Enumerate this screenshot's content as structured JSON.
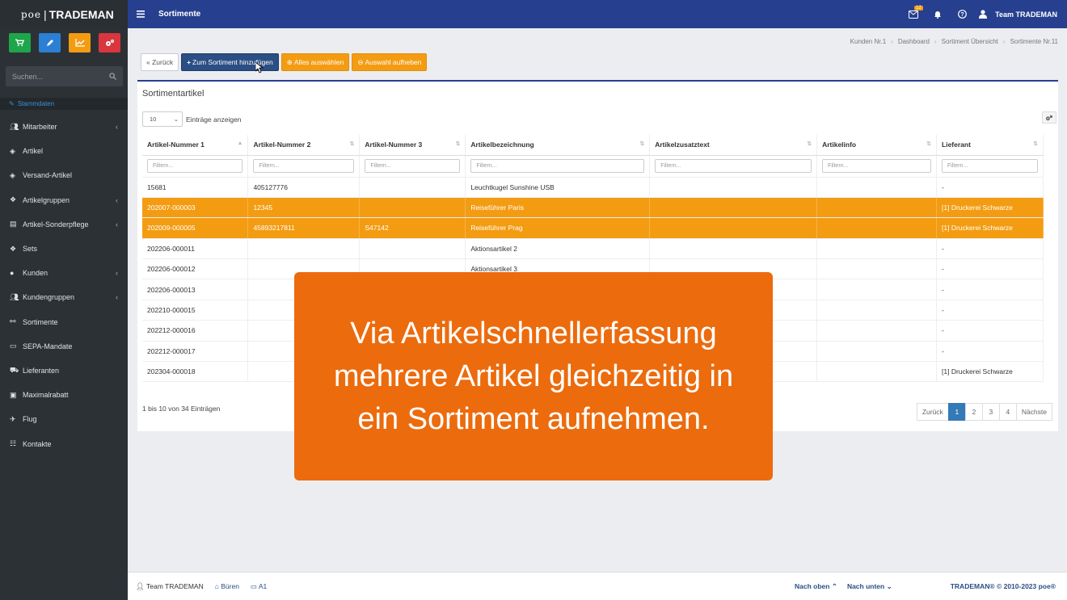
{
  "brand": {
    "poe": "poe",
    "name": "TRADEMAN"
  },
  "quick_buttons": [
    {
      "name": "cart-icon",
      "color": "#1fa54a"
    },
    {
      "name": "pencil-icon",
      "color": "#2b7fd4"
    },
    {
      "name": "chart-icon",
      "color": "#f39c12"
    },
    {
      "name": "gears-icon",
      "color": "#d9363e"
    }
  ],
  "search": {
    "placeholder": "Suchen..."
  },
  "sidebar": {
    "section": "Stammdaten",
    "items": [
      {
        "label": "Mitarbeiter",
        "icon": "users-icon",
        "has_sub": true
      },
      {
        "label": "Artikel",
        "icon": "cube-icon",
        "has_sub": false
      },
      {
        "label": "Versand-Artikel",
        "icon": "cube-icon",
        "has_sub": false
      },
      {
        "label": "Artikelgruppen",
        "icon": "cubes-icon",
        "has_sub": true
      },
      {
        "label": "Artikel-Sonderpflege",
        "icon": "table-icon",
        "has_sub": true
      },
      {
        "label": "Sets",
        "icon": "cubes-icon",
        "has_sub": false
      },
      {
        "label": "Kunden",
        "icon": "user-icon",
        "has_sub": true
      },
      {
        "label": "Kundengruppen",
        "icon": "users-icon",
        "has_sub": true
      },
      {
        "label": "Sortimente",
        "icon": "sitemap-icon",
        "has_sub": false
      },
      {
        "label": "SEPA-Mandate",
        "icon": "credit-card-icon",
        "has_sub": false
      },
      {
        "label": "Lieferanten",
        "icon": "truck-icon",
        "has_sub": false
      },
      {
        "label": "Maximalrabatt",
        "icon": "money-icon",
        "has_sub": false
      },
      {
        "label": "Flug",
        "icon": "plane-icon",
        "has_sub": false
      },
      {
        "label": "Kontakte",
        "icon": "contact-icon",
        "has_sub": false
      }
    ]
  },
  "topbar": {
    "title": "Sortimente",
    "badge": "12",
    "user": "Team TRADEMAN"
  },
  "breadcrumb": [
    "Kunden Nr.1",
    "Dashboard",
    "Sortiment Übersicht",
    "Sortimente Nr.11"
  ],
  "toolbar": {
    "back": "« Zurück",
    "add": "Zum Sortiment hinzufügen",
    "select_all": "Alles auswählen",
    "deselect": "Auswahl aufheben"
  },
  "card": {
    "title": "Sortimentartikel",
    "length_value": "10",
    "length_label": "Einträge anzeigen"
  },
  "table": {
    "columns": [
      "Artikel-Nummer 1",
      "Artikel-Nummer 2",
      "Artikel-Nummer 3",
      "Artikelbezeichnung",
      "Artikelzusatztext",
      "Artikelinfo",
      "Lieferant"
    ],
    "filter_placeholder": "Filtern...",
    "rows": [
      {
        "c": [
          "15681",
          "405127776",
          "",
          "Leuchtkugel Sunshine USB",
          "",
          "",
          "-"
        ],
        "selected": false
      },
      {
        "c": [
          "202007-000003",
          "12345",
          "",
          "Reiseführer Paris",
          "",
          "",
          "[1] Druckerei Schwarze"
        ],
        "selected": true
      },
      {
        "c": [
          "202009-000005",
          "45893217811",
          "S47142",
          "Reiseführer Prag",
          "",
          "",
          "[1] Druckerei Schwarze"
        ],
        "selected": true
      },
      {
        "c": [
          "202206-000011",
          "",
          "",
          "Aktionsartikel 2",
          "",
          "",
          "-"
        ],
        "selected": false
      },
      {
        "c": [
          "202206-000012",
          "",
          "",
          "Aktionsartikel 3",
          "",
          "",
          "-"
        ],
        "selected": false
      },
      {
        "c": [
          "202206-000013",
          "",
          "",
          "",
          "",
          "",
          "-"
        ],
        "selected": false
      },
      {
        "c": [
          "202210-000015",
          "",
          "",
          "",
          "",
          "",
          "-"
        ],
        "selected": false
      },
      {
        "c": [
          "202212-000016",
          "",
          "",
          "",
          "",
          "",
          "-"
        ],
        "selected": false
      },
      {
        "c": [
          "202212-000017",
          "",
          "",
          "",
          "",
          "",
          "-"
        ],
        "selected": false
      },
      {
        "c": [
          "202304-000018",
          "",
          "",
          "",
          "",
          "",
          "[1] Druckerei Schwarze"
        ],
        "selected": false
      }
    ]
  },
  "info": "1 bis 10 von 34 Einträgen",
  "pager": {
    "prev": "Zurück",
    "pages": [
      "1",
      "2",
      "3",
      "4"
    ],
    "active": "1",
    "next": "Nächste"
  },
  "overlay": {
    "lines": [
      "Via Artikelschnellerfassung",
      "mehrere Artikel gleichzeitig in",
      "ein Sortiment aufnehmen."
    ],
    "color": "#ec6b0d"
  },
  "footer": {
    "user": "Team TRADEMAN",
    "location": "Büren",
    "workstation": "A1",
    "top": "Nach oben",
    "bottom": "Nach unten",
    "copyright": "TRADEMAN® © 2010-2023 poe®"
  }
}
